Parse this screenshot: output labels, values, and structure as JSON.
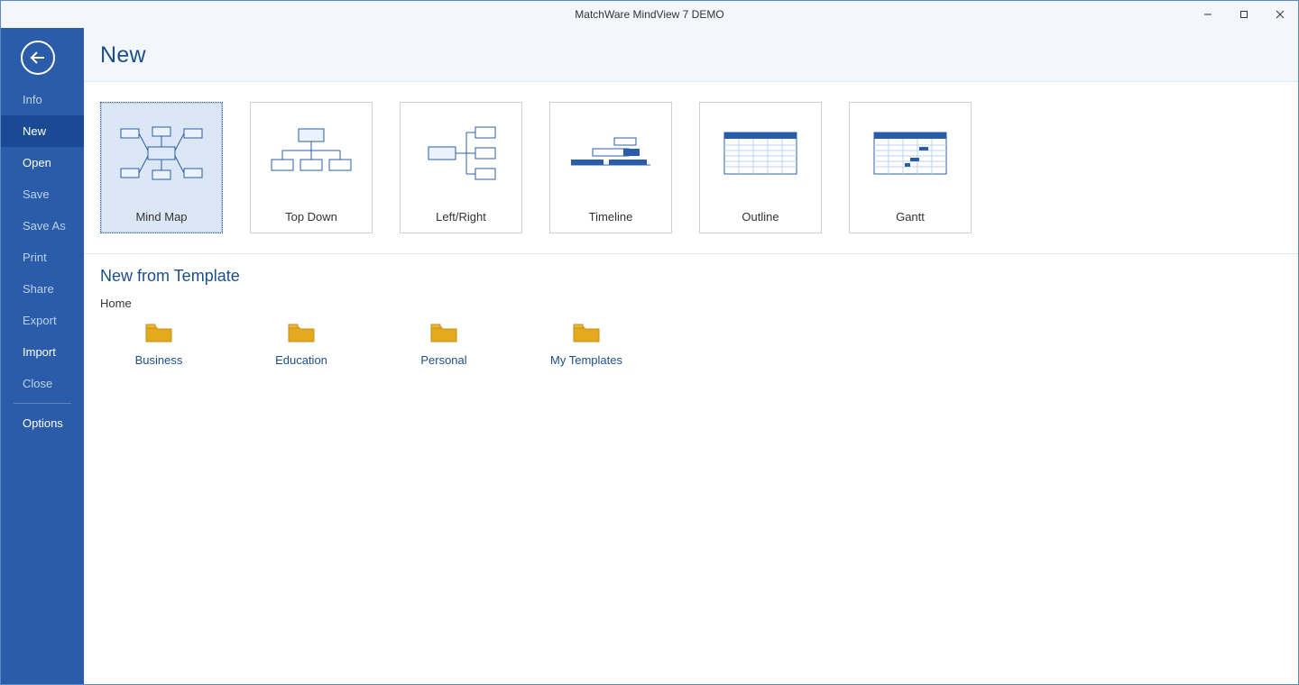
{
  "window": {
    "title": "MatchWare MindView 7 DEMO"
  },
  "sidebar": {
    "items": [
      {
        "label": "Info",
        "enabled": false,
        "active": false
      },
      {
        "label": "New",
        "enabled": true,
        "active": true
      },
      {
        "label": "Open",
        "enabled": true,
        "active": false
      },
      {
        "label": "Save",
        "enabled": false,
        "active": false
      },
      {
        "label": "Save As",
        "enabled": false,
        "active": false
      },
      {
        "label": "Print",
        "enabled": false,
        "active": false
      },
      {
        "label": "Share",
        "enabled": false,
        "active": false
      },
      {
        "label": "Export",
        "enabled": false,
        "active": false
      },
      {
        "label": "Import",
        "enabled": true,
        "active": false
      },
      {
        "label": "Close",
        "enabled": false,
        "active": false
      },
      {
        "label": "Options",
        "enabled": true,
        "active": false
      }
    ]
  },
  "page": {
    "title": "New",
    "tiles": [
      {
        "label": "Mind Map",
        "selected": true,
        "icon": "mindmap"
      },
      {
        "label": "Top Down",
        "selected": false,
        "icon": "topdown"
      },
      {
        "label": "Left/Right",
        "selected": false,
        "icon": "leftright"
      },
      {
        "label": "Timeline",
        "selected": false,
        "icon": "timeline"
      },
      {
        "label": "Outline",
        "selected": false,
        "icon": "outline"
      },
      {
        "label": "Gantt",
        "selected": false,
        "icon": "gantt"
      }
    ],
    "template_section_title": "New from Template",
    "template_breadcrumb": "Home",
    "template_folders": [
      {
        "label": "Business"
      },
      {
        "label": "Education"
      },
      {
        "label": "Personal"
      },
      {
        "label": "My Templates"
      }
    ]
  }
}
